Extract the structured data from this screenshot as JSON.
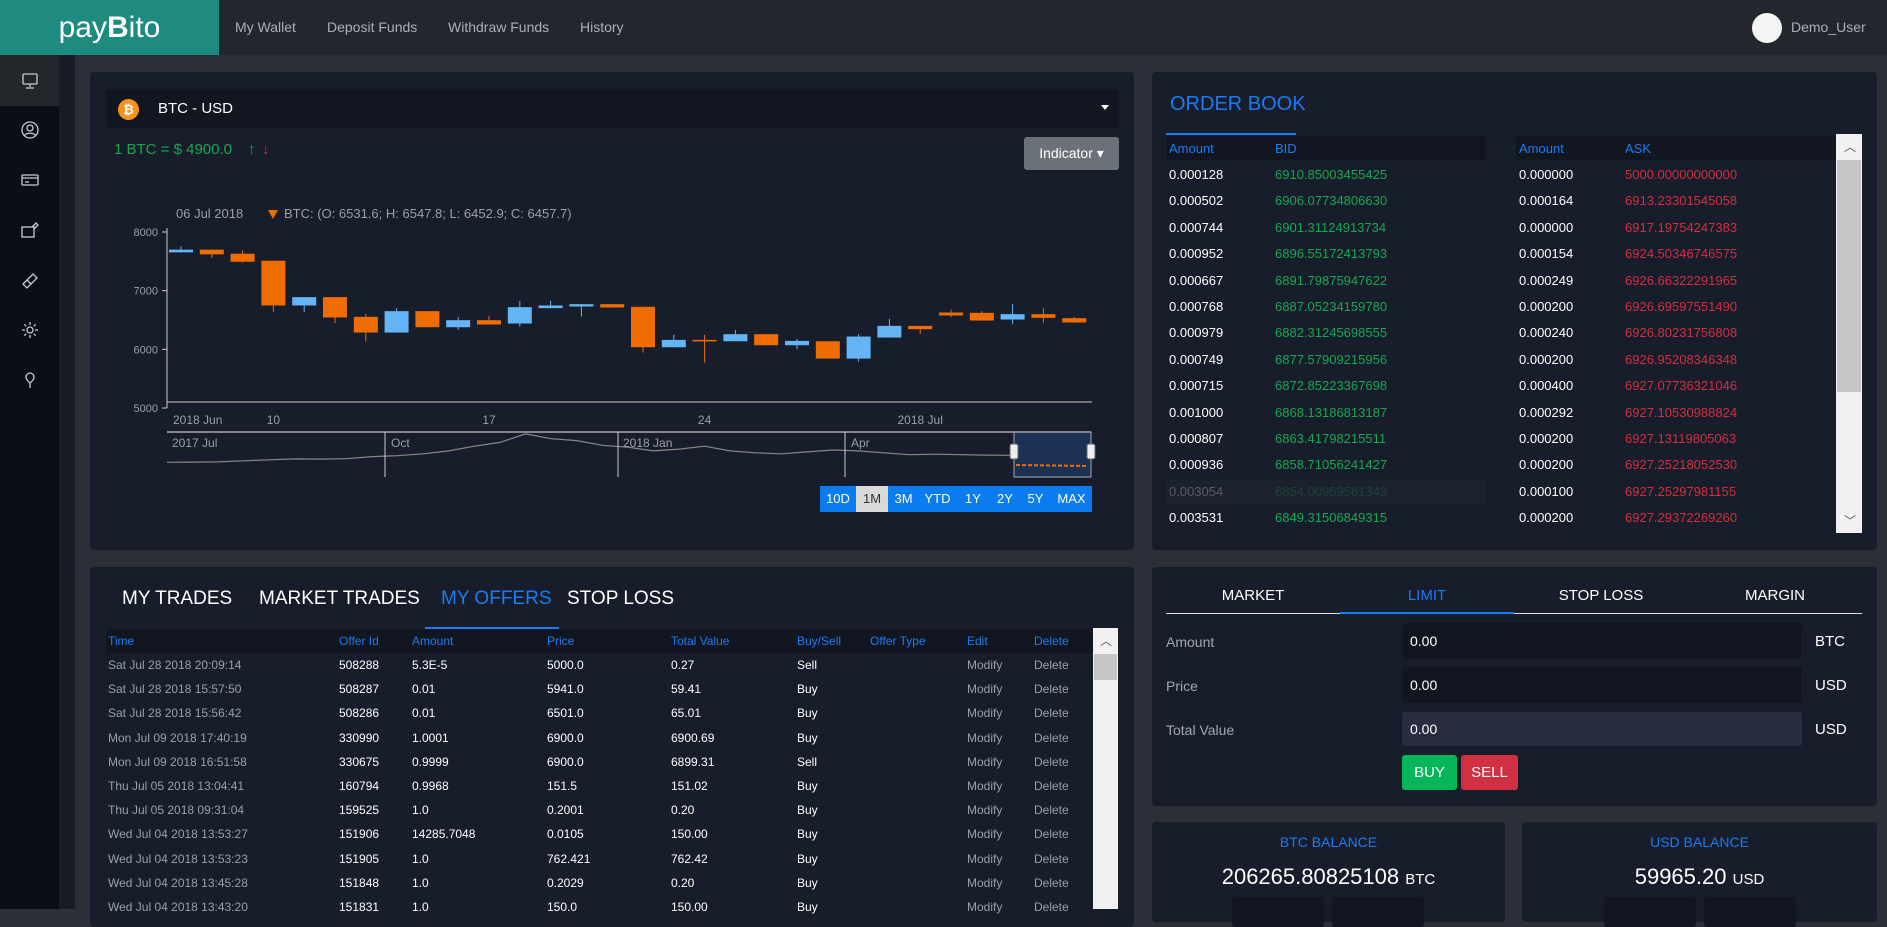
{
  "app": {
    "logo_pre": "pay",
    "logo_b": "B",
    "logo_post": "ito",
    "user": "Demo_User"
  },
  "nav": [
    {
      "label": "My Wallet"
    },
    {
      "label": "Deposit Funds"
    },
    {
      "label": "Withdraw Funds"
    },
    {
      "label": "History"
    }
  ],
  "sidebar": [
    {
      "icon": "monitor-icon"
    },
    {
      "icon": "user-circle-icon"
    },
    {
      "icon": "credit-card-icon"
    },
    {
      "icon": "wallet-edit-icon"
    },
    {
      "icon": "ticket-icon"
    },
    {
      "icon": "gear-icon"
    },
    {
      "icon": "pin-icon"
    }
  ],
  "pair": {
    "label": "BTC - USD",
    "rate": "1 BTC = $ 4900.0",
    "indicator": "Indicator"
  },
  "colors": {
    "up": "#64b5f6",
    "down": "#ef6c00",
    "green": "#17a851",
    "red": "#d12f42",
    "accent": "#1a7cf2"
  },
  "chart_data": {
    "type": "candlestick",
    "tooltip_date": "06 Jul 2018",
    "tooltip": "BTC: (O: 6531.6; H: 6547.8; L: 6452.9; C: 6457.7)",
    "ylim": [
      5000,
      8000
    ],
    "yticks": [
      "8000",
      "7000",
      "6000",
      "5000"
    ],
    "xticks": [
      {
        "label": "2018 Jun",
        "index": 0
      },
      {
        "label": "10",
        "index": 3
      },
      {
        "label": "17",
        "index": 10
      },
      {
        "label": "24",
        "index": 17
      },
      {
        "label": "2018 Jul",
        "index": 24
      }
    ],
    "candles": [
      [
        7653,
        7755,
        7653,
        7699
      ],
      [
        7699,
        7699,
        7556,
        7619
      ],
      [
        7630,
        7687,
        7480,
        7493
      ],
      [
        7510,
        7510,
        6640,
        6748
      ],
      [
        6748,
        6890,
        6634,
        6890
      ],
      [
        6890,
        6890,
        6446,
        6543
      ],
      [
        6554,
        6605,
        6133,
        6286
      ],
      [
        6286,
        6702,
        6286,
        6651
      ],
      [
        6651,
        6651,
        6377,
        6377
      ],
      [
        6377,
        6548,
        6332,
        6497
      ],
      [
        6497,
        6571,
        6423,
        6423
      ],
      [
        6440,
        6827,
        6389,
        6719
      ],
      [
        6702,
        6827,
        6702,
        6748
      ],
      [
        6730,
        6770,
        6560,
        6770
      ],
      [
        6770,
        6770,
        6713,
        6713
      ],
      [
        6725,
        6725,
        5945,
        6036
      ],
      [
        6036,
        6247,
        6036,
        6161
      ],
      [
        6161,
        6247,
        5774,
        6138
      ],
      [
        6138,
        6332,
        6138,
        6258
      ],
      [
        6258,
        6258,
        6070,
        6070
      ],
      [
        6070,
        6178,
        6007,
        6144
      ],
      [
        6138,
        6138,
        5842,
        5842
      ],
      [
        5842,
        6258,
        5791,
        6218
      ],
      [
        6201,
        6520,
        6201,
        6400
      ],
      [
        6400,
        6400,
        6264,
        6343
      ],
      [
        6628,
        6674,
        6548,
        6577
      ],
      [
        6622,
        6650,
        6491,
        6491
      ],
      [
        6508,
        6770,
        6429,
        6600
      ],
      [
        6600,
        6702,
        6457,
        6537
      ],
      [
        6531.6,
        6547.8,
        6452.9,
        6457.7
      ]
    ],
    "navigator": {
      "labels": [
        "2017 Jul",
        "Oct",
        "2018 Jan",
        "Apr"
      ],
      "values": [
        2500,
        2600,
        2700,
        3300,
        3800,
        4300,
        4200,
        4400,
        5500,
        6000,
        7000,
        8500,
        11000,
        13000,
        17500,
        15000,
        14000,
        11500,
        10500,
        8500,
        9500,
        11000,
        8500,
        7500,
        7000,
        8000,
        9000,
        8500,
        7500,
        6500,
        6800,
        6500,
        6300,
        6200
      ]
    },
    "range_buttons": [
      "10D",
      "1M",
      "3M",
      "YTD",
      "1Y",
      "2Y",
      "5Y",
      "MAX"
    ],
    "range_selected": "1M"
  },
  "orderbook": {
    "title": "ORDER BOOK",
    "headers": {
      "amount": "Amount",
      "bid": "BID",
      "ask": "ASK"
    },
    "bids": [
      [
        "0.000128",
        "6910.85003455425"
      ],
      [
        "0.000502",
        "6906.07734806630"
      ],
      [
        "0.000744",
        "6901.31124913734"
      ],
      [
        "0.000952",
        "6896.55172413793"
      ],
      [
        "0.000667",
        "6891.79875947622"
      ],
      [
        "0.000768",
        "6887.05234159780"
      ],
      [
        "0.000979",
        "6882.31245698555"
      ],
      [
        "0.000749",
        "6877.57909215956"
      ],
      [
        "0.000715",
        "6872.85223367698"
      ],
      [
        "0.001000",
        "6868.13186813187"
      ],
      [
        "0.000807",
        "6863.41798215511"
      ],
      [
        "0.000936",
        "6858.71056241427"
      ],
      [
        "0.003054",
        "6854.00959561343"
      ],
      [
        "0.003531",
        "6849.31506849315"
      ]
    ],
    "asks": [
      [
        "0.000000",
        "5000.00000000000"
      ],
      [
        "0.000164",
        "6913.23301545058"
      ],
      [
        "0.000000",
        "6917.19754247383"
      ],
      [
        "0.000154",
        "6924.50346746575"
      ],
      [
        "0.000249",
        "6926.66322291965"
      ],
      [
        "0.000200",
        "6926.69597551490"
      ],
      [
        "0.000240",
        "6926.80231756808"
      ],
      [
        "0.000200",
        "6926.95208346348"
      ],
      [
        "0.000400",
        "6927.07736321046"
      ],
      [
        "0.000292",
        "6927.10530988824"
      ],
      [
        "0.000200",
        "6927.13119805063"
      ],
      [
        "0.000200",
        "6927.25218052530"
      ],
      [
        "0.000100",
        "6927.25297981155"
      ],
      [
        "0.000200",
        "6927.29372269260"
      ]
    ]
  },
  "trades": {
    "tabs": [
      "MY TRADES",
      "MARKET TRADES",
      "MY OFFERS",
      "STOP LOSS"
    ],
    "active": "MY OFFERS",
    "headers": [
      "Time",
      "Offer Id",
      "Amount",
      "Price",
      "Total Value",
      "Buy/Sell",
      "Offer Type",
      "Edit",
      "Delete"
    ],
    "rows": [
      [
        "Sat Jul 28 2018 20:09:14",
        "508288",
        "5.3E-5",
        "5000.0",
        "0.27",
        "Sell",
        "",
        "Modify",
        "Delete"
      ],
      [
        "Sat Jul 28 2018 15:57:50",
        "508287",
        "0.01",
        "5941.0",
        "59.41",
        "Buy",
        "",
        "Modify",
        "Delete"
      ],
      [
        "Sat Jul 28 2018 15:56:42",
        "508286",
        "0.01",
        "6501.0",
        "65.01",
        "Buy",
        "",
        "Modify",
        "Delete"
      ],
      [
        "Mon Jul 09 2018 17:40:19",
        "330990",
        "1.0001",
        "6900.0",
        "6900.69",
        "Buy",
        "",
        "Modify",
        "Delete"
      ],
      [
        "Mon Jul 09 2018 16:51:58",
        "330675",
        "0.9999",
        "6900.0",
        "6899.31",
        "Sell",
        "",
        "Modify",
        "Delete"
      ],
      [
        "Thu Jul 05 2018 13:04:41",
        "160794",
        "0.9968",
        "151.5",
        "151.02",
        "Buy",
        "",
        "Modify",
        "Delete"
      ],
      [
        "Thu Jul 05 2018 09:31:04",
        "159525",
        "1.0",
        "0.2001",
        "0.20",
        "Buy",
        "",
        "Modify",
        "Delete"
      ],
      [
        "Wed Jul 04 2018 13:53:27",
        "151906",
        "14285.7048",
        "0.0105",
        "150.00",
        "Buy",
        "",
        "Modify",
        "Delete"
      ],
      [
        "Wed Jul 04 2018 13:53:23",
        "151905",
        "1.0",
        "762.421",
        "762.42",
        "Buy",
        "",
        "Modify",
        "Delete"
      ],
      [
        "Wed Jul 04 2018 13:45:28",
        "151848",
        "1.0",
        "0.2029",
        "0.20",
        "Buy",
        "",
        "Modify",
        "Delete"
      ],
      [
        "Wed Jul 04 2018 13:43:20",
        "151831",
        "1.0",
        "150.0",
        "150.00",
        "Buy",
        "",
        "Modify",
        "Delete"
      ]
    ]
  },
  "form": {
    "tabs": [
      "MARKET",
      "LIMIT",
      "STOP LOSS",
      "MARGIN"
    ],
    "active": "LIMIT",
    "amount_label": "Amount",
    "amount": "0.00",
    "amount_unit": "BTC",
    "price_label": "Price",
    "price": "0.00",
    "price_unit": "USD",
    "total_label": "Total Value",
    "total": "0.00",
    "total_unit": "USD",
    "buy": "BUY",
    "sell": "SELL"
  },
  "balances": {
    "btc_title": "BTC BALANCE",
    "btc_value": "206265.80825108",
    "btc_unit": "BTC",
    "usd_title": "USD BALANCE",
    "usd_value": "59965.20",
    "usd_unit": "USD"
  }
}
